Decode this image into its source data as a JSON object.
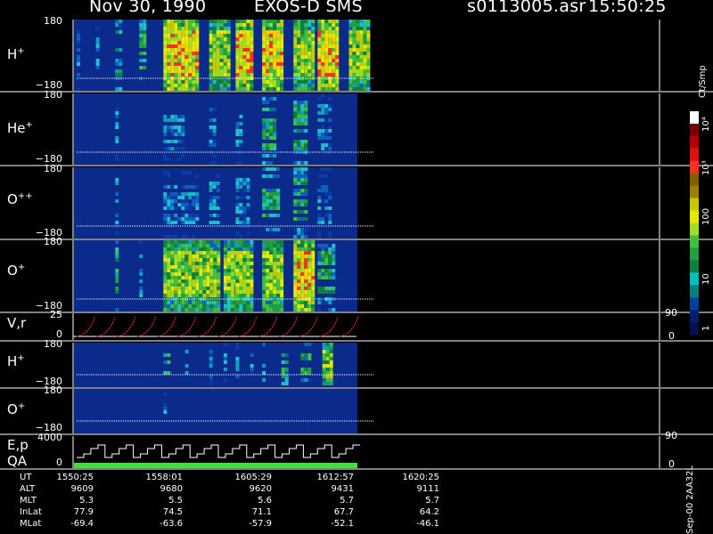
{
  "header": {
    "date": "Nov 30, 1990",
    "instrument": "EXOS-D SMS",
    "file": "s0113005.asr",
    "time": "15:50:25"
  },
  "colorbar": {
    "unit_label": "Ct/Smp",
    "ticks": [
      "10⁴",
      "10³",
      "100",
      "10",
      "1"
    ],
    "colors": [
      "#ffffff",
      "#7a0000",
      "#b40000",
      "#e01010",
      "#ff3020",
      "#806000",
      "#a08000",
      "#c8c800",
      "#e8e800",
      "#a0e020",
      "#40c040",
      "#20a040",
      "#108040",
      "#00c0c0",
      "#008080",
      "#0040a0",
      "#002070",
      "#001050"
    ]
  },
  "footer": {
    "side_label": "Sep-00 2AA32L",
    "rows": [
      {
        "name": "UT",
        "values": [
          "1550:25",
          "1558:01",
          "1605:29",
          "1612:57",
          "1620:25"
        ]
      },
      {
        "name": "ALT",
        "values": [
          "9609",
          "9680",
          "9620",
          "9431",
          "9111"
        ]
      },
      {
        "name": "MLT",
        "values": [
          "5.3",
          "5.5",
          "5.6",
          "5.7",
          "5.7"
        ]
      },
      {
        "name": "InLat",
        "values": [
          "77.9",
          "74.5",
          "71.1",
          "67.7",
          "64.2"
        ]
      },
      {
        "name": "MLat",
        "values": [
          "-69.4",
          "-63.6",
          "-57.9",
          "-52.1",
          "-46.1"
        ]
      }
    ]
  },
  "chart_data": [
    {
      "type": "heatmap",
      "panel": "H+",
      "label": "H",
      "label_sup": "+",
      "ylim": [
        -180,
        180
      ],
      "ytick_top": "180",
      "ytick_bottom": "−180",
      "bursts": [
        [
          0.0,
          0.01,
          1
        ],
        [
          0.08,
          0.02,
          1
        ],
        [
          0.16,
          0.03,
          2
        ],
        [
          0.26,
          0.04,
          2
        ],
        [
          0.36,
          0.15,
          4
        ],
        [
          0.55,
          0.09,
          3
        ],
        [
          0.66,
          0.08,
          4
        ],
        [
          0.77,
          0.1,
          4
        ],
        [
          0.9,
          0.09,
          3
        ],
        [
          1.0,
          0.1,
          4
        ],
        [
          1.13,
          0.1,
          3
        ]
      ]
    },
    {
      "type": "heatmap",
      "panel": "He+",
      "label": "He",
      "label_sup": "+",
      "ylim": [
        -180,
        180
      ],
      "ytick_top": "180",
      "ytick_bottom": "−180",
      "bursts": [
        [
          0.16,
          0.01,
          1
        ],
        [
          0.36,
          0.1,
          1
        ],
        [
          0.55,
          0.03,
          1
        ],
        [
          0.66,
          0.03,
          1
        ],
        [
          0.77,
          0.06,
          2
        ],
        [
          0.9,
          0.06,
          2
        ],
        [
          1.0,
          0.06,
          1
        ]
      ]
    },
    {
      "type": "heatmap",
      "panel": "O++",
      "label": "O",
      "label_sup": "++",
      "ylim": [
        -180,
        180
      ],
      "ytick_top": "180",
      "ytick_bottom": "−180",
      "bursts": [
        [
          0.16,
          0.01,
          1
        ],
        [
          0.36,
          0.15,
          1
        ],
        [
          0.55,
          0.05,
          1
        ],
        [
          0.66,
          0.06,
          1
        ],
        [
          0.77,
          0.08,
          2
        ],
        [
          0.9,
          0.06,
          2
        ],
        [
          1.0,
          0.06,
          1
        ]
      ]
    },
    {
      "type": "heatmap",
      "panel": "O+",
      "label": "O",
      "label_sup": "+",
      "ylim": [
        -180,
        180
      ],
      "ytick_top": "180",
      "ytick_bottom": "−180",
      "bursts": [
        [
          0.16,
          0.02,
          2
        ],
        [
          0.26,
          0.01,
          1
        ],
        [
          0.36,
          0.25,
          3
        ],
        [
          0.61,
          0.08,
          3
        ],
        [
          0.66,
          0.08,
          3
        ],
        [
          0.77,
          0.1,
          3
        ],
        [
          0.9,
          0.1,
          4
        ],
        [
          1.0,
          0.08,
          2
        ]
      ]
    },
    {
      "type": "line",
      "panel": "V,r",
      "label": "V,r",
      "ylim": [
        0,
        25
      ],
      "ytick_top": "25",
      "ytick_bottom": "0",
      "right_top": "90",
      "right_bottom": "0",
      "sawtooth_cycles": 14
    },
    {
      "type": "heatmap",
      "panel": "H+ (2)",
      "label": "H",
      "label_sup": "+",
      "ylim": [
        -180,
        180
      ],
      "ytick_top": "180",
      "ytick_bottom": "−180",
      "bursts": [
        [
          0.36,
          0.03,
          2
        ],
        [
          0.45,
          0.02,
          1
        ],
        [
          0.55,
          0.02,
          1
        ],
        [
          0.61,
          0.02,
          1
        ],
        [
          0.66,
          0.02,
          1
        ],
        [
          0.72,
          0.02,
          1
        ],
        [
          0.77,
          0.02,
          2
        ],
        [
          0.85,
          0.03,
          2
        ],
        [
          0.93,
          0.05,
          2
        ],
        [
          1.02,
          0.05,
          3
        ]
      ]
    },
    {
      "type": "heatmap",
      "panel": "O+ (2)",
      "label": "O",
      "label_sup": "+",
      "ylim": [
        -180,
        180
      ],
      "ytick_top": "180",
      "ytick_bottom": "−180",
      "bursts": [
        [
          0.36,
          0.01,
          1
        ]
      ]
    },
    {
      "type": "line",
      "panel": "E,p QA",
      "label": "E,p",
      "label2": "QA",
      "ylim": [
        0,
        4000
      ],
      "ytick_top": "4000",
      "ytick_bottom": "0",
      "right_top": "90",
      "right_bottom": "0",
      "step_cycles": 10
    }
  ]
}
